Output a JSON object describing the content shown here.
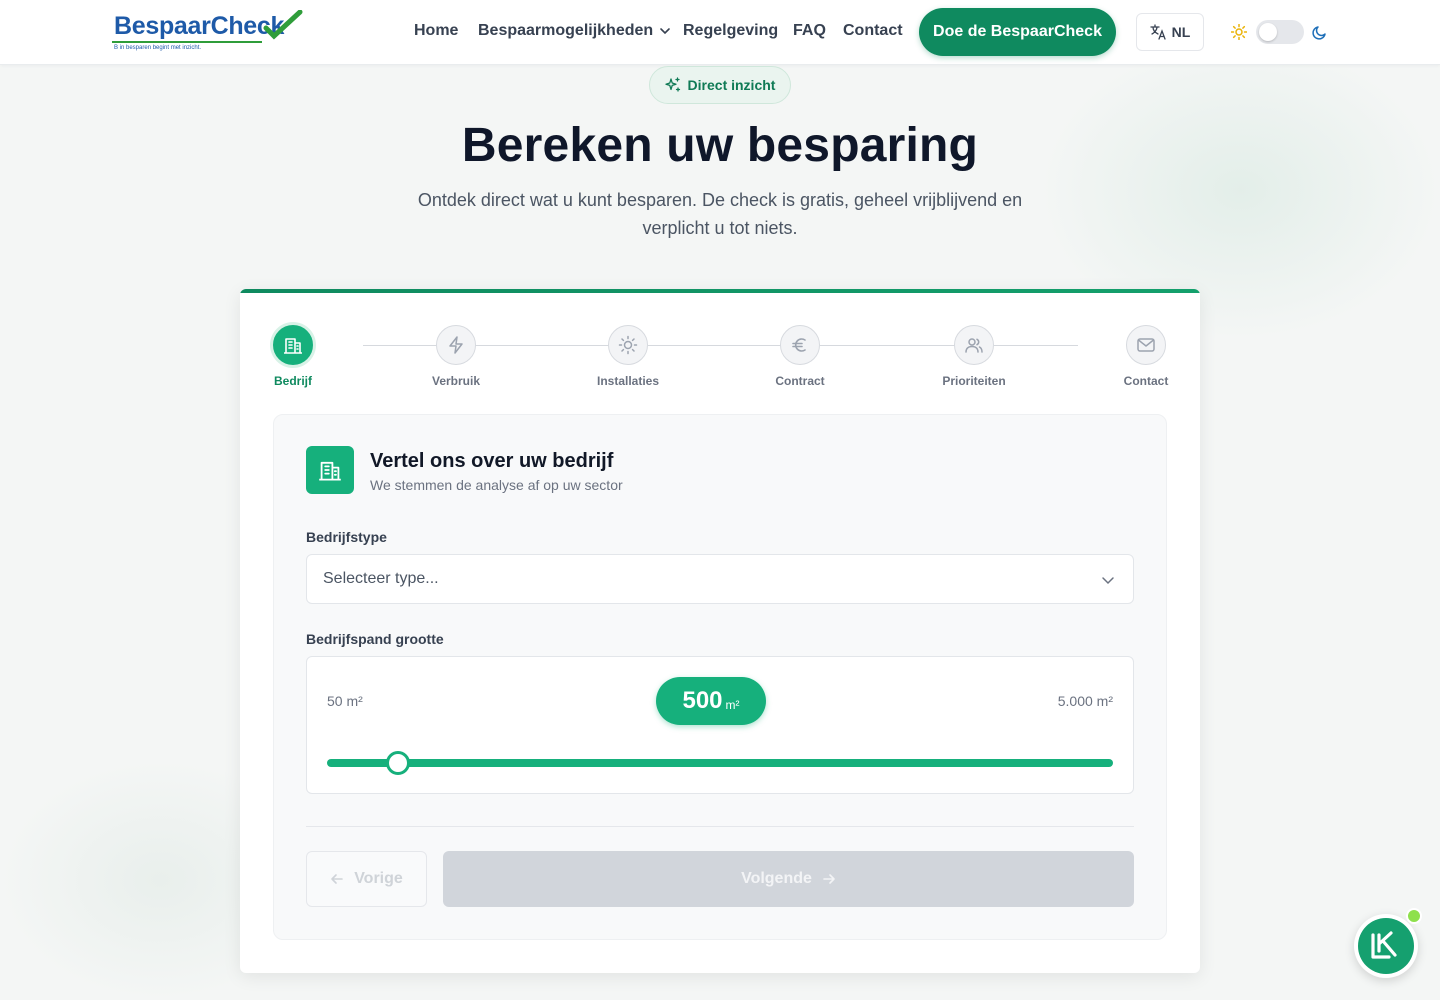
{
  "header": {
    "logo": {
      "name": "BespaarCheck",
      "tagline": "B in besparen begint met inzicht."
    },
    "nav": [
      {
        "label": "Home"
      },
      {
        "label": "Bespaarmogelijkheden"
      },
      {
        "label": "Regelgeving"
      },
      {
        "label": "FAQ"
      },
      {
        "label": "Contact"
      }
    ],
    "cta_label": "Doe de BespaarCheck",
    "language": "NL",
    "theme_toggle": {
      "dark_mode": false
    }
  },
  "hero": {
    "badge": "Direct inzicht",
    "title": "Bereken uw besparing",
    "subtitle": "Ontdek direct wat u kunt besparen. De check is gratis, geheel vrijblijvend en verplicht u tot niets."
  },
  "steps": [
    {
      "label": "Bedrijf",
      "icon": "building-icon",
      "active": true
    },
    {
      "label": "Verbruik",
      "icon": "lightning-icon",
      "active": false
    },
    {
      "label": "Installaties",
      "icon": "sun-icon",
      "active": false
    },
    {
      "label": "Contract",
      "icon": "euro-icon",
      "active": false
    },
    {
      "label": "Prioriteiten",
      "icon": "users-icon",
      "active": false
    },
    {
      "label": "Contact",
      "icon": "mail-icon",
      "active": false
    }
  ],
  "form": {
    "section_title": "Vertel ons over uw bedrijf",
    "section_subtitle": "We stemmen de analyse af op uw sector",
    "company_type": {
      "label": "Bedrijfstype",
      "placeholder": "Selecteer type..."
    },
    "size": {
      "label": "Bedrijfspand grootte",
      "min_label": "50 m²",
      "max_label": "5.000 m²",
      "value": "500",
      "unit": "m²",
      "min": 50,
      "max": 5000,
      "current": 500
    },
    "prev_label": "Vorige",
    "next_label": "Volgende"
  },
  "colors": {
    "primary": "#0f8a5f",
    "accent": "#16b07c",
    "brand_blue": "#1e5aa8"
  }
}
